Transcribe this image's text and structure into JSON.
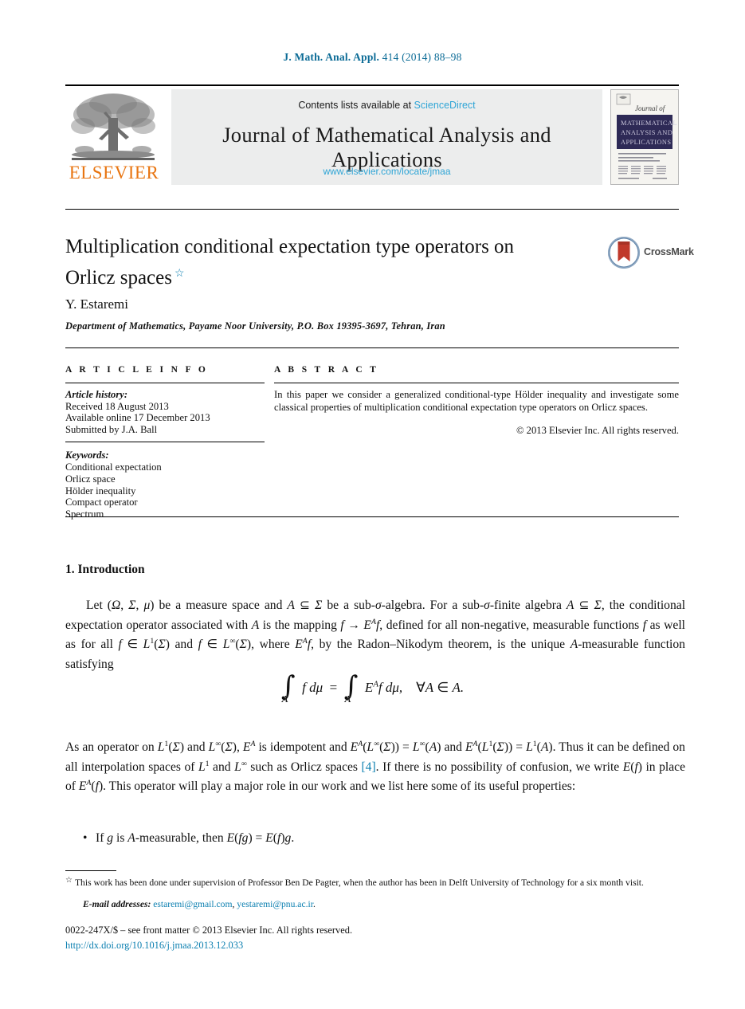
{
  "running_head": {
    "journal_abbrev": "J. Math. Anal. Appl.",
    "volume_year_pages": "414 (2014) 88–98",
    "color": "#0b6b96"
  },
  "masthead": {
    "contents_prefix": "Contents lists available at",
    "sciencedirect": "ScienceDirect",
    "journal_title": "Journal of Mathematical Analysis and Applications",
    "journal_url": "www.elsevier.com/locate/jmaa",
    "publisher_name": "ELSEVIER",
    "publisher_color": "#E87511",
    "link_color": "#2fa5d6",
    "cover_lines": [
      "Journal of",
      "MATHEMATICAL",
      "ANALYSIS AND",
      "APPLICATIONS"
    ]
  },
  "article": {
    "title": "Multiplication conditional expectation type operators on Orlicz spaces",
    "title_footnote_marker": "☆",
    "author": "Y. Estaremi",
    "affiliation": "Department of Mathematics, Payame Noor University, P.O. Box 19395-3697, Tehran, Iran"
  },
  "article_info": {
    "heading": "A R T I C L E   I N F O",
    "history_label": "Article history:",
    "history": [
      "Received 18 August 2013",
      "Available online 17 December 2013",
      "Submitted by J.A. Ball"
    ],
    "keywords_label": "Keywords:",
    "keywords": [
      "Conditional expectation",
      "Orlicz space",
      "Hölder inequality",
      "Compact operator",
      "Spectrum"
    ]
  },
  "abstract": {
    "heading": "A B S T R A C T",
    "text": "In this paper we consider a generalized conditional-type Hölder inequality and investigate some classical properties of multiplication conditional expectation type operators on Orlicz spaces.",
    "copyright": "© 2013 Elsevier Inc. All rights reserved."
  },
  "body": {
    "section_title": "1. Introduction",
    "paragraph_1_html": "Let (<i>Ω</i>, <i>Σ</i>, <i>μ</i>) be a measure space and <i>A</i> ⊆ <i>Σ</i> be a sub-<i>σ</i>-algebra. For a sub-<i>σ</i>-finite algebra <i>A</i> ⊆ <i>Σ</i>, the conditional expectation operator associated with <i>A</i> is the mapping <i>f</i> → <i>E</i><sup><i>A</i></sup><i>f</i>, defined for all non-negative, measurable functions <i>f</i> as well as for all <i>f</i> ∈ <i>L</i><sup>1</sup>(<i>Σ</i>) and <i>f</i> ∈ <i>L</i><sup>∞</sup>(<i>Σ</i>), where <i>E</i><sup><i>A</i></sup><i>f</i>, by the Radon–Nikodym theorem, is the unique <i>A</i>-measurable function satisfying",
    "equation": "∫_A f dμ = ∫_A E^A f dμ,  ∀A ∈ A.",
    "paragraph_2_html": "As an operator on <i>L</i><sup>1</sup>(<i>Σ</i>) and <i>L</i><sup>∞</sup>(<i>Σ</i>), <i>E</i><sup><i>A</i></sup> is idempotent and <i>E</i><sup><i>A</i></sup>(<i>L</i><sup>∞</sup>(<i>Σ</i>)) = <i>L</i><sup>∞</sup>(<i>A</i>) and <i>E</i><sup><i>A</i></sup>(<i>L</i><sup>1</sup>(<i>Σ</i>)) = <i>L</i><sup>1</sup>(<i>A</i>). Thus it can be defined on all interpolation spaces of <i>L</i><sup>1</sup> and <i>L</i><sup>∞</sup> such as Orlicz spaces [4]. If there is no possibility of confusion, we write <i>E</i>(<i>f</i>) in place of <i>E</i><sup><i>A</i></sup>(<i>f</i>). This operator will play a major role in our work and we list here some of its useful properties:",
    "citation_number": "[4]",
    "bullet_1_html": "If <i>g</i> is <i>A</i>-measurable, then <i>E</i>(<i>fg</i>) = <i>E</i>(<i>f</i>)<i>g</i>."
  },
  "footer": {
    "footnote_marker": "☆",
    "footnote_text": "This work has been done under supervision of Professor Ben De Pagter, when the author has been in Delft University of Technology for a six month visit.",
    "emails_label": "E-mail addresses:",
    "emails": [
      "estaremi@gmail.com",
      "yestaremi@pnu.ac.ir"
    ],
    "issn_line": "0022-247X/$ – see front matter  © 2013 Elsevier Inc. All rights reserved.",
    "doi_line": "http://dx.doi.org/10.1016/j.jmaa.2013.12.033",
    "link_color": "#0b7fb0"
  }
}
